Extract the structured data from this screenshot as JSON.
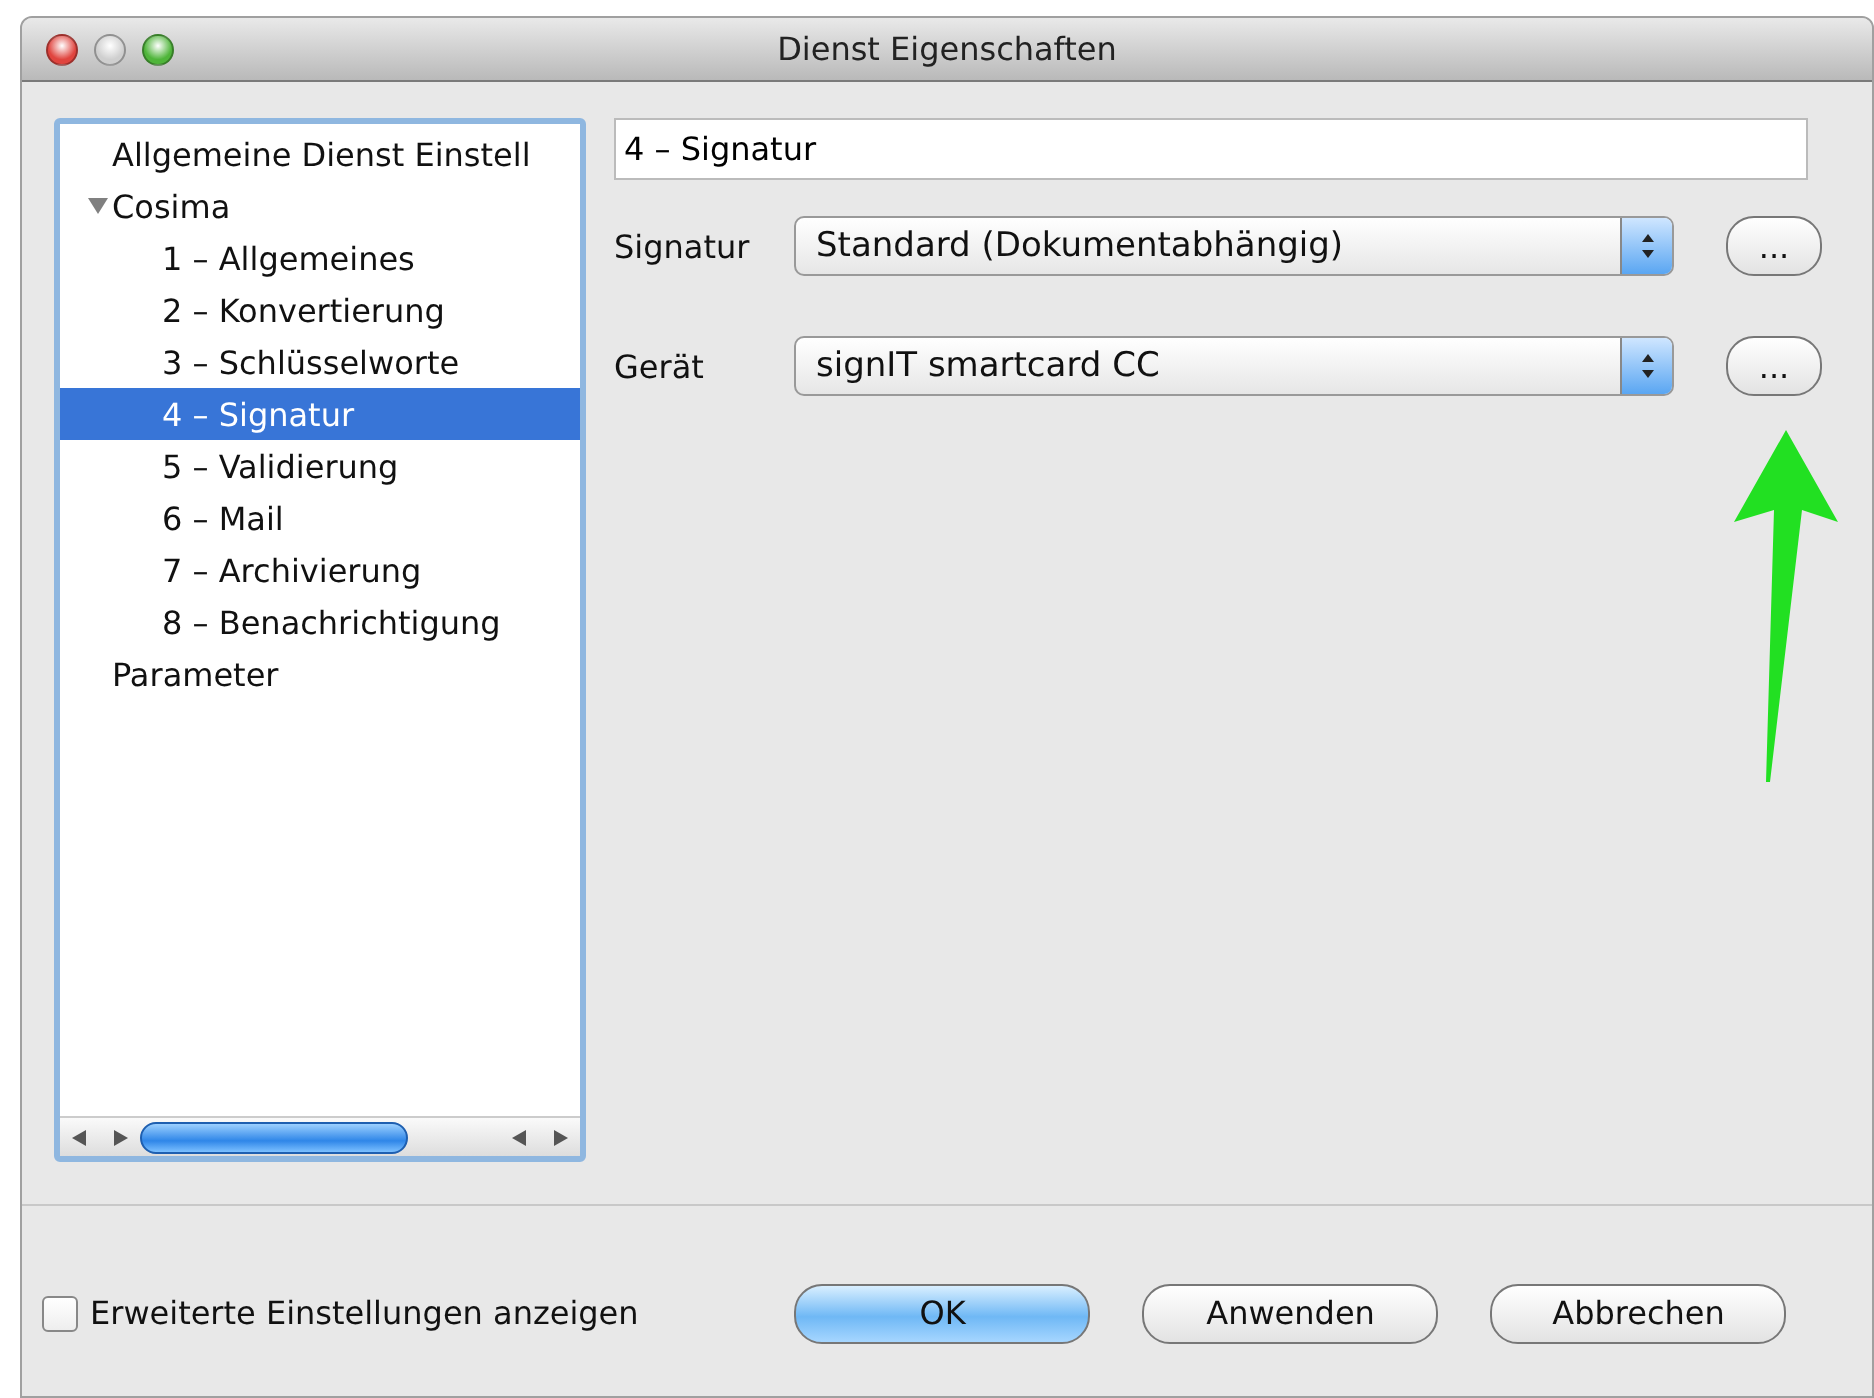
{
  "window": {
    "title": "Dienst Eigenschaften"
  },
  "tree": [
    {
      "label": "Allgemeine Dienst Einstell",
      "selected": false
    },
    {
      "label": "Cosima",
      "selected": false,
      "expanded": true,
      "children": [
        {
          "label": "1 – Allgemeines",
          "selected": false
        },
        {
          "label": "2 – Konvertierung",
          "selected": false
        },
        {
          "label": "3 – Schlüsselworte",
          "selected": false
        },
        {
          "label": "4 – Signatur",
          "selected": true
        },
        {
          "label": "5 – Validierung",
          "selected": false
        },
        {
          "label": "6 – Mail",
          "selected": false
        },
        {
          "label": "7 – Archivierung",
          "selected": false
        },
        {
          "label": "8 – Benachrichtigung",
          "selected": false
        }
      ]
    },
    {
      "label": "Parameter",
      "selected": false
    }
  ],
  "section_title": "4 – Signatur",
  "fields": [
    {
      "label": "Signatur",
      "value": "Standard (Dokumentabhängig)",
      "button": "..."
    },
    {
      "label": "Gerät",
      "value": "signIT smartcard CC",
      "button": "..."
    }
  ],
  "footer": {
    "checkbox": {
      "label": "Erweiterte Einstellungen anzeigen",
      "checked": false
    },
    "buttons": [
      {
        "label": "OK",
        "default": true
      },
      {
        "label": "Anwenden",
        "default": false
      },
      {
        "label": "Abbrechen",
        "default": false
      }
    ]
  }
}
